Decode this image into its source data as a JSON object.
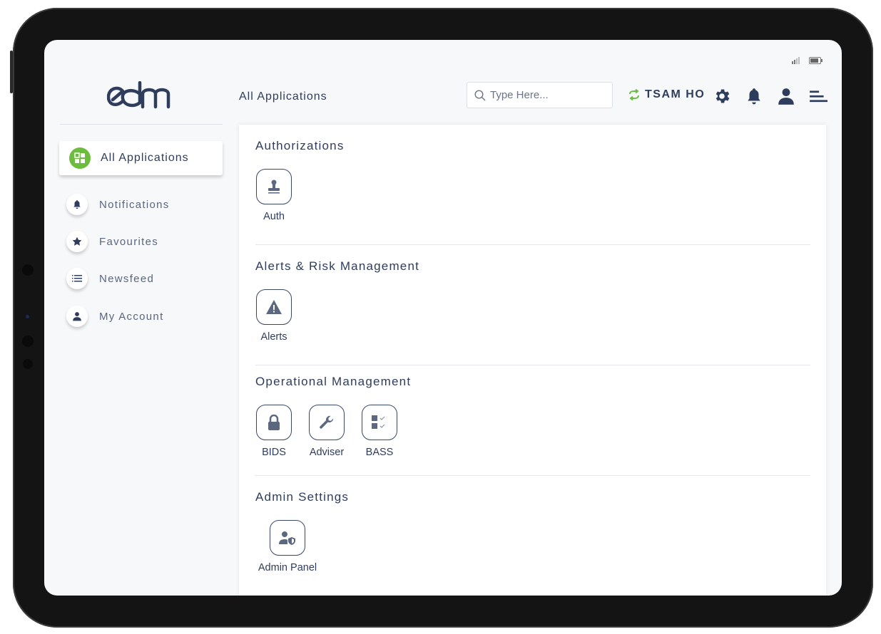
{
  "header": {
    "logo_text": "edm",
    "page_title": "All Applications",
    "search": {
      "placeholder": "Type Here...",
      "value": ""
    },
    "user_label": "TSAM HO",
    "accent_color": "#6cbd3e",
    "text_color": "#2f3d5c",
    "icons": [
      "signal-icon",
      "battery-icon",
      "search-icon",
      "sync-icon",
      "gear-icon",
      "bell-icon",
      "user-icon",
      "menu-icon"
    ]
  },
  "sidebar": {
    "active": {
      "label": "All Applications",
      "icon": "grid-icon"
    },
    "items": [
      {
        "label": "Notifications",
        "icon": "bell-icon"
      },
      {
        "label": "Favourites",
        "icon": "star-icon"
      },
      {
        "label": "Newsfeed",
        "icon": "list-icon"
      },
      {
        "label": "My Account",
        "icon": "user-icon"
      }
    ]
  },
  "sections": [
    {
      "title": "Authorizations",
      "apps": [
        {
          "label": "Auth",
          "icon": "stamp-icon"
        }
      ]
    },
    {
      "title": "Alerts & Risk Management",
      "apps": [
        {
          "label": "Alerts",
          "icon": "warning-icon"
        }
      ]
    },
    {
      "title": "Operational Management",
      "apps": [
        {
          "label": "BIDS",
          "icon": "lock-icon"
        },
        {
          "label": "Adviser",
          "icon": "wrench-icon"
        },
        {
          "label": "BASS",
          "icon": "checklist-icon"
        }
      ]
    },
    {
      "title": "Admin Settings",
      "apps": [
        {
          "label": "Admin Panel",
          "icon": "user-shield-icon"
        }
      ]
    }
  ]
}
